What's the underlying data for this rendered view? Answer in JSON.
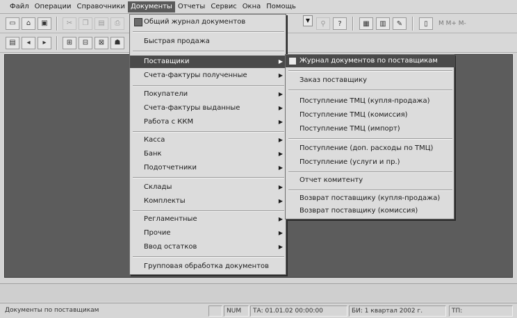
{
  "menubar": {
    "items": [
      {
        "label": "Файл"
      },
      {
        "label": "Операции"
      },
      {
        "label": "Справочники"
      },
      {
        "label": "Документы"
      },
      {
        "label": "Отчеты"
      },
      {
        "label": "Сервис"
      },
      {
        "label": "Окна"
      },
      {
        "label": "Помощь"
      }
    ]
  },
  "toolbar1": {
    "buttons": [
      "new-icon",
      "open-icon",
      "save-icon",
      "cut-icon",
      "copy-icon",
      "paste-icon",
      "print-icon"
    ],
    "right_buttons": [
      "find-icon",
      "help-icon",
      "window-icon",
      "calendar-icon",
      "chat-icon",
      "book-icon"
    ],
    "calc_label": "M  M+  M-"
  },
  "toolbar2": {
    "buttons": [
      "journal-icon",
      "back-icon",
      "forward-icon",
      "doc1-icon",
      "doc2-icon",
      "doc3-icon",
      "people-icon"
    ]
  },
  "documents_menu": {
    "items": [
      {
        "label": "Общий журнал документов",
        "has_icon": true
      },
      {
        "label": "Быстрая продажа"
      },
      {
        "label": "Поставщики",
        "submenu": true,
        "highlighted": true
      },
      {
        "label": "Счета-фактуры полученные",
        "submenu": true
      },
      {
        "label": "Покупатели",
        "submenu": true
      },
      {
        "label": "Счета-фактуры выданные",
        "submenu": true
      },
      {
        "label": "Работа с ККМ",
        "submenu": true
      },
      {
        "label": "Касса",
        "submenu": true
      },
      {
        "label": "Банк",
        "submenu": true
      },
      {
        "label": "Подотчетники",
        "submenu": true
      },
      {
        "label": "Склады",
        "submenu": true
      },
      {
        "label": "Комплекты",
        "submenu": true
      },
      {
        "label": "Регламентные",
        "submenu": true
      },
      {
        "label": "Прочие",
        "submenu": true
      },
      {
        "label": "Ввод остатков",
        "submenu": true
      },
      {
        "label": "Групповая обработка документов"
      }
    ]
  },
  "suppliers_submenu": {
    "items": [
      {
        "label": "Журнал документов по поставщикам",
        "highlighted": true
      },
      {
        "label": "Заказ поставщику"
      },
      {
        "label": "Поступление ТМЦ (купля-продажа)"
      },
      {
        "label": "Поступление ТМЦ (комиссия)"
      },
      {
        "label": "Поступление ТМЦ (импорт)"
      },
      {
        "label": "Поступление (доп. расходы по ТМЦ)"
      },
      {
        "label": "Поступление (услуги и пр.)"
      },
      {
        "label": "Отчет комитенту"
      },
      {
        "label": "Возврат поставщику (купля-продажа)"
      },
      {
        "label": "Возврат поставщику (комиссия)"
      }
    ]
  },
  "statusbar": {
    "message": "Документы по поставщикам",
    "num": "NUM",
    "ta": "ТА: 01.01.02  00:00:00",
    "bi": "БИ: 1 квартал 2002 г.",
    "tp": "ТП:"
  },
  "colors": {
    "workspace": "#5c5c5c",
    "highlight": "#4a4a4a",
    "menu_bg": "#dcdcdc"
  }
}
